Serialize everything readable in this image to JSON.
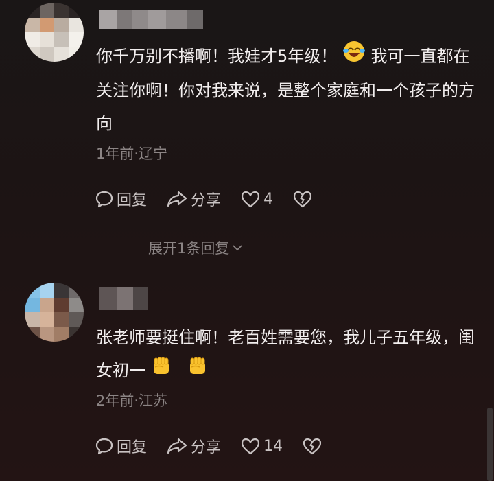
{
  "comments": [
    {
      "avatar_icon": "blurred-avatar",
      "text_before": "你千万别不播啊！我娃才5年级！ ",
      "emoji_1": "laughing-crying-emoji",
      "text_after": " 我可一直都在关注你啊！你对我来说，是整个家庭和一个孩子的方向",
      "meta": "1年前·辽宁",
      "reply_label": "回复",
      "share_label": "分享",
      "like_count": "4",
      "dislike_icon": "broken-heart-icon"
    },
    {
      "avatar_icon": "blurred-avatar",
      "text_before": "张老师要挺住啊！老百姓需要您，我儿子五年级，闺女初一",
      "emoji_1": "fist-emoji",
      "emoji_2": "fist-emoji",
      "meta": "2年前·江苏",
      "reply_label": "回复",
      "share_label": "分享",
      "like_count": "14",
      "dislike_icon": "broken-heart-icon"
    }
  ],
  "expand_replies": "展开1条回复",
  "colors": {
    "background": "#1b1515",
    "text": "#f2eeee",
    "meta": "#8c8585",
    "action": "#c9c3c3"
  }
}
